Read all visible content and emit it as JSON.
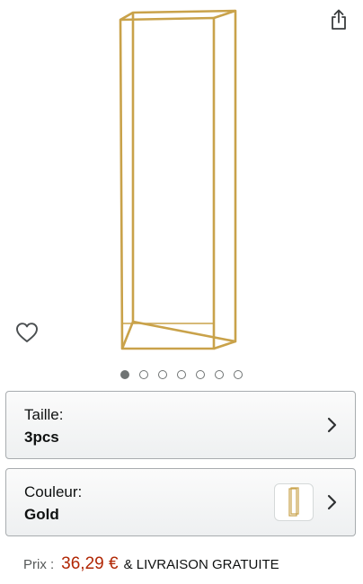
{
  "product": {
    "image_icon": "gold-rectangular-frame-stand",
    "frame_color": "#c9a24a"
  },
  "actions": {
    "share_icon": "share-icon",
    "wishlist_icon": "heart-outline-icon"
  },
  "carousel": {
    "total": 7,
    "active_index": 0
  },
  "options": {
    "size": {
      "label": "Taille:",
      "value": "3pcs"
    },
    "color": {
      "label": "Couleur:",
      "value": "Gold"
    }
  },
  "price": {
    "label": "Prix :",
    "amount": "36,29 €",
    "shipping": "& LIVRAISON GRATUITE",
    "amount_color": "#b12704"
  }
}
